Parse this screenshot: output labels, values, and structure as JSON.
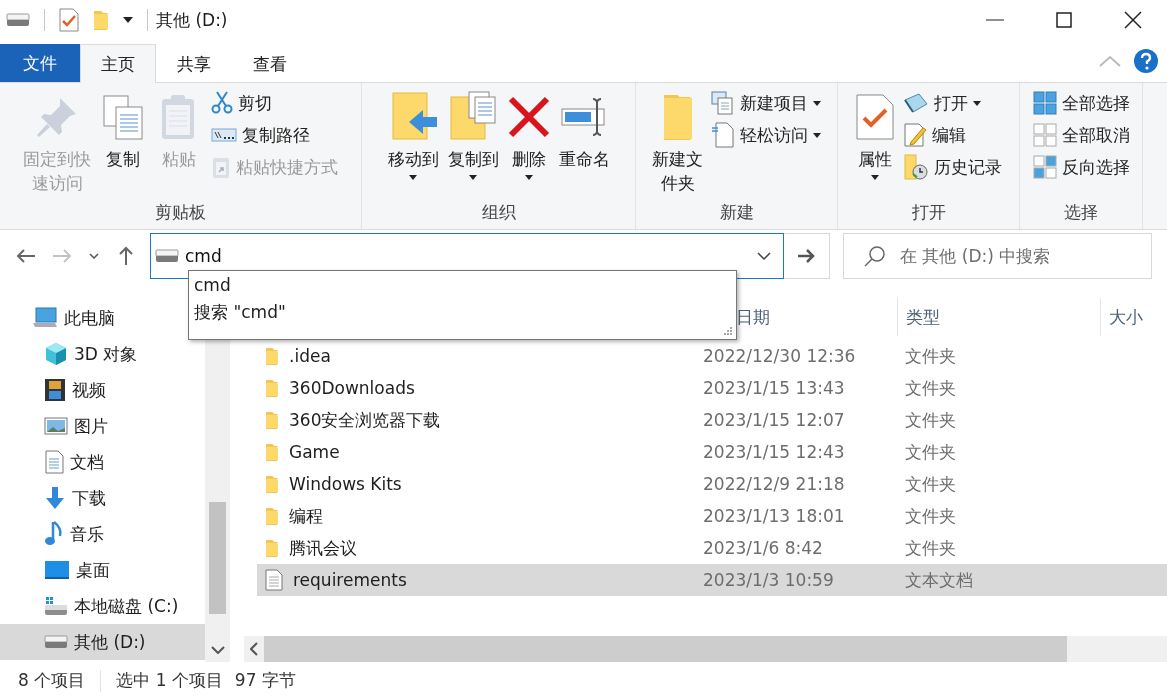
{
  "window": {
    "title": "其他 (D:)"
  },
  "tabs": [
    {
      "label": "文件",
      "kind": "menu",
      "selected": false
    },
    {
      "label": "主页",
      "kind": "tab",
      "selected": true
    },
    {
      "label": "共享",
      "kind": "tab",
      "selected": false
    },
    {
      "label": "查看",
      "kind": "tab",
      "selected": false
    }
  ],
  "ribbon": {
    "groups": [
      {
        "label": "剪贴板",
        "items": [
          {
            "label": "固定到快速访问",
            "kind": "large",
            "disabled": true,
            "dropdown": false
          },
          {
            "label": "复制",
            "kind": "large",
            "disabled": false,
            "dropdown": false
          },
          {
            "label": "粘贴",
            "kind": "large",
            "disabled": true,
            "dropdown": false
          },
          {
            "label": "剪切",
            "kind": "small",
            "disabled": false,
            "dropdown": false
          },
          {
            "label": "复制路径",
            "kind": "small",
            "disabled": false,
            "dropdown": false
          },
          {
            "label": "粘贴快捷方式",
            "kind": "small",
            "disabled": true,
            "dropdown": false
          }
        ]
      },
      {
        "label": "组织",
        "items": [
          {
            "label": "移动到",
            "kind": "large",
            "disabled": false,
            "dropdown": true
          },
          {
            "label": "复制到",
            "kind": "large",
            "disabled": false,
            "dropdown": true
          },
          {
            "label": "删除",
            "kind": "large",
            "disabled": false,
            "dropdown": true
          },
          {
            "label": "重命名",
            "kind": "large",
            "disabled": false,
            "dropdown": false
          }
        ]
      },
      {
        "label": "新建",
        "items": [
          {
            "label": "新建文件夹",
            "kind": "large",
            "disabled": false,
            "dropdown": false
          },
          {
            "label": "新建项目",
            "kind": "small",
            "disabled": false,
            "dropdown": true
          },
          {
            "label": "轻松访问",
            "kind": "small",
            "disabled": false,
            "dropdown": true
          }
        ]
      },
      {
        "label": "打开",
        "items": [
          {
            "label": "属性",
            "kind": "large",
            "disabled": false,
            "dropdown": true
          },
          {
            "label": "打开",
            "kind": "small",
            "disabled": false,
            "dropdown": true
          },
          {
            "label": "编辑",
            "kind": "small",
            "disabled": false,
            "dropdown": false
          },
          {
            "label": "历史记录",
            "kind": "small",
            "disabled": false,
            "dropdown": false
          }
        ]
      },
      {
        "label": "选择",
        "items": [
          {
            "label": "全部选择",
            "kind": "small",
            "disabled": false,
            "dropdown": false
          },
          {
            "label": "全部取消",
            "kind": "small",
            "disabled": false,
            "dropdown": false
          },
          {
            "label": "反向选择",
            "kind": "small",
            "disabled": false,
            "dropdown": false
          }
        ]
      }
    ]
  },
  "navigation": {
    "back": {
      "disabled": false
    },
    "forward": {
      "disabled": true
    }
  },
  "address_bar": {
    "value": "cmd"
  },
  "autocomplete": {
    "suggestions": [
      "cmd",
      "搜索 \"cmd\""
    ]
  },
  "search": {
    "placeholder": "在 其他 (D:) 中搜索"
  },
  "nav_pane": {
    "items": [
      {
        "label": "此电脑",
        "selected": false,
        "children": [
          {
            "label": "3D 对象",
            "selected": false
          },
          {
            "label": "视频",
            "selected": false
          },
          {
            "label": "图片",
            "selected": false
          },
          {
            "label": "文档",
            "selected": false
          },
          {
            "label": "下载",
            "selected": false
          },
          {
            "label": "音乐",
            "selected": false
          },
          {
            "label": "桌面",
            "selected": false
          },
          {
            "label": "本地磁盘 (C:)",
            "selected": false
          },
          {
            "label": "其他 (D:)",
            "selected": true
          }
        ]
      }
    ]
  },
  "file_list": {
    "columns": [
      "日期",
      "类型",
      "大小"
    ],
    "rows": [
      {
        "name": ".idea",
        "date": "2022/12/30 12:36",
        "type": "文件夹",
        "kind": "folder",
        "selected": false
      },
      {
        "name": "360Downloads",
        "date": "2023/1/15 13:43",
        "type": "文件夹",
        "kind": "folder",
        "selected": false
      },
      {
        "name": "360安全浏览器下载",
        "date": "2023/1/15 12:07",
        "type": "文件夹",
        "kind": "folder",
        "selected": false
      },
      {
        "name": "Game",
        "date": "2023/1/15 12:43",
        "type": "文件夹",
        "kind": "folder",
        "selected": false
      },
      {
        "name": "Windows Kits",
        "date": "2022/12/9 21:18",
        "type": "文件夹",
        "kind": "folder",
        "selected": false
      },
      {
        "name": "编程",
        "date": "2023/1/13 18:01",
        "type": "文件夹",
        "kind": "folder",
        "selected": false
      },
      {
        "name": "腾讯会议",
        "date": "2023/1/6 8:42",
        "type": "文件夹",
        "kind": "folder",
        "selected": false
      },
      {
        "name": "requirements",
        "date": "2023/1/3 10:59",
        "type": "文本文档",
        "kind": "text",
        "selected": true
      }
    ]
  },
  "status_bar": {
    "item_count": "8 个项目",
    "selection": "选中 1 个项目",
    "selection_size": "97 字节"
  }
}
